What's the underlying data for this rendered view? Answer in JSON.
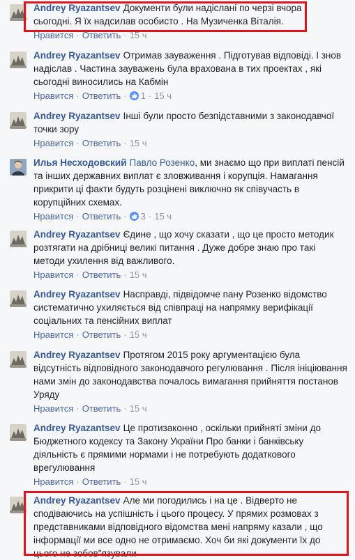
{
  "colors": {
    "author": "#365899",
    "action": "#4b67a1",
    "meta": "#90949c",
    "highlight": "#e0141c",
    "like": "#5890ff"
  },
  "actions": {
    "like": "Нравится",
    "reply": "Ответить",
    "separator": "·"
  },
  "comments": [
    {
      "author": "Andrey Ryazantsev",
      "text": "Документи були надіслані по черзі вчора і сьогодні. Я їх надсилав особисто . На Музиченка Віталія.",
      "likes": "",
      "time": "15 ч",
      "highlighted": true
    },
    {
      "author": "Andrey Ryazantsev",
      "text": "Отримав зауваження . Підготував відповіді. І знов надіслав . Частина зауважень була врахована в тих проектах , які сьогодні виносились на Кабмін",
      "likes": "1",
      "time": "15 ч"
    },
    {
      "author": "Andrey Ryazantsev",
      "text": "Інші були просто безпідставними з законодавчої точки зору",
      "likes": "",
      "time": "15 ч"
    },
    {
      "author": "Илья Несходовский",
      "mention": "Павло Розенко",
      "text": ", ми знаємо що при виплаті пенсій та інших державних виплат є зловживання і корупція. Намагання прикрити ці факти будуть розцінені виключно як співучасть в корупційних схемах.",
      "likes": "3",
      "time": "15 ч"
    },
    {
      "author": "Andrey Ryazantsev",
      "text": "Єдине , що хочу сказати , що це просто методик розтягати на дрібниці великі питання . Дуже добре знаю про такі методи ухилення від важливого.",
      "likes": "",
      "time": "15 ч"
    },
    {
      "author": "Andrey Ryazantsev",
      "text": "Насправді, підвідомче пану Розенко відомство систематично ухиляється від співпраці на напрямку верифікації соціальних та пенсійних виплат",
      "likes": "",
      "time": "15 ч"
    },
    {
      "author": "Andrey Ryazantsev",
      "text": "Протягом 2015 року аргументацією була відсутність відповідного законодавчого регулювання . Після ініціювання нами змін до законодавства почалось вимагання прийняття постанов Уряду",
      "likes": "",
      "time": "15 ч"
    },
    {
      "author": "Andrey Ryazantsev",
      "text": "Це протизаконно , оскільки прийняті зміни до Бюджетного кодексу та Закону України Про банки і банківську діяльність є прямими нормами і не потребують додаткового врегулювання",
      "likes": "",
      "time": "15 ч"
    },
    {
      "author": "Andrey Ryazantsev",
      "text": "Але ми погодились і на це . Відверто не сподіваючись на успішність і цього процесу. У прямих розмовах з представниками відповідного відомства мені напряму казали , що інформації ми все одно не отримаємо. Хоч би які документи їх до цього не зобов\"язували",
      "likes": "",
      "time": "",
      "highlighted": true
    }
  ]
}
